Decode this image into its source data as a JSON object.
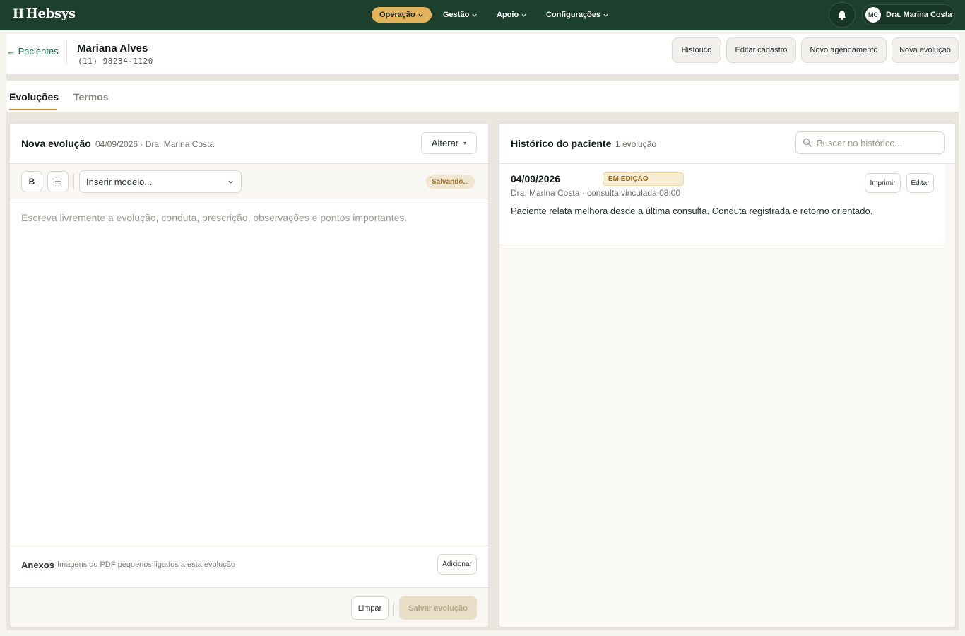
{
  "brand": {
    "mark": "H",
    "name": "Hebsys"
  },
  "nav": {
    "items": [
      {
        "label": "Operação",
        "active": true
      },
      {
        "label": "Gestão",
        "active": false
      },
      {
        "label": "Apoio",
        "active": false
      },
      {
        "label": "Configurações",
        "active": false
      }
    ],
    "user": {
      "initials": "MC",
      "name": "Dra. Marina Costa"
    }
  },
  "patient": {
    "back_label": "← Pacientes",
    "name": "Mariana Alves",
    "phone": "(11) 98234-1120",
    "actions": [
      "Histórico",
      "Editar cadastro",
      "Novo agendamento",
      "Nova evolução"
    ]
  },
  "tabs": [
    {
      "label": "Evoluções",
      "active": true
    },
    {
      "label": "Termos",
      "active": false
    }
  ],
  "new_evolution": {
    "title": "Nova evolução",
    "meta": "04/09/2026 · Dra. Marina Costa",
    "change_label": "Alterar",
    "toolbar": {
      "bold_label": "B",
      "list_label": "☰",
      "model_placeholder": "Inserir modelo...",
      "status": "Salvando..."
    },
    "editor_placeholder": "Escreva livremente a evolução, conduta, prescrição, observações e pontos importantes.",
    "attachments": {
      "label": "Anexos",
      "hint": "Imagens ou PDF pequenos ligados a esta evolução",
      "add_label": "Adicionar"
    },
    "clear_label": "Limpar",
    "save_label": "Salvar evolução"
  },
  "history": {
    "title": "Histórico do paciente",
    "count": "1 evolução",
    "search_placeholder": "Buscar no histórico...",
    "entries": [
      {
        "date": "04/09/2026",
        "badge": "EM EDIÇÃO",
        "meta": "Dra. Marina Costa · consulta vinculada 08:00",
        "text": "Paciente relata melhora desde a última consulta. Conduta registrada e retorno orientado.",
        "print_label": "Imprimir",
        "edit_label": "Editar"
      }
    ]
  },
  "colors": {
    "nav_bg": "#1d3f2d",
    "accent": "#e2b35a",
    "link": "#1d6b45",
    "badge_bg": "#f6ebd3"
  }
}
